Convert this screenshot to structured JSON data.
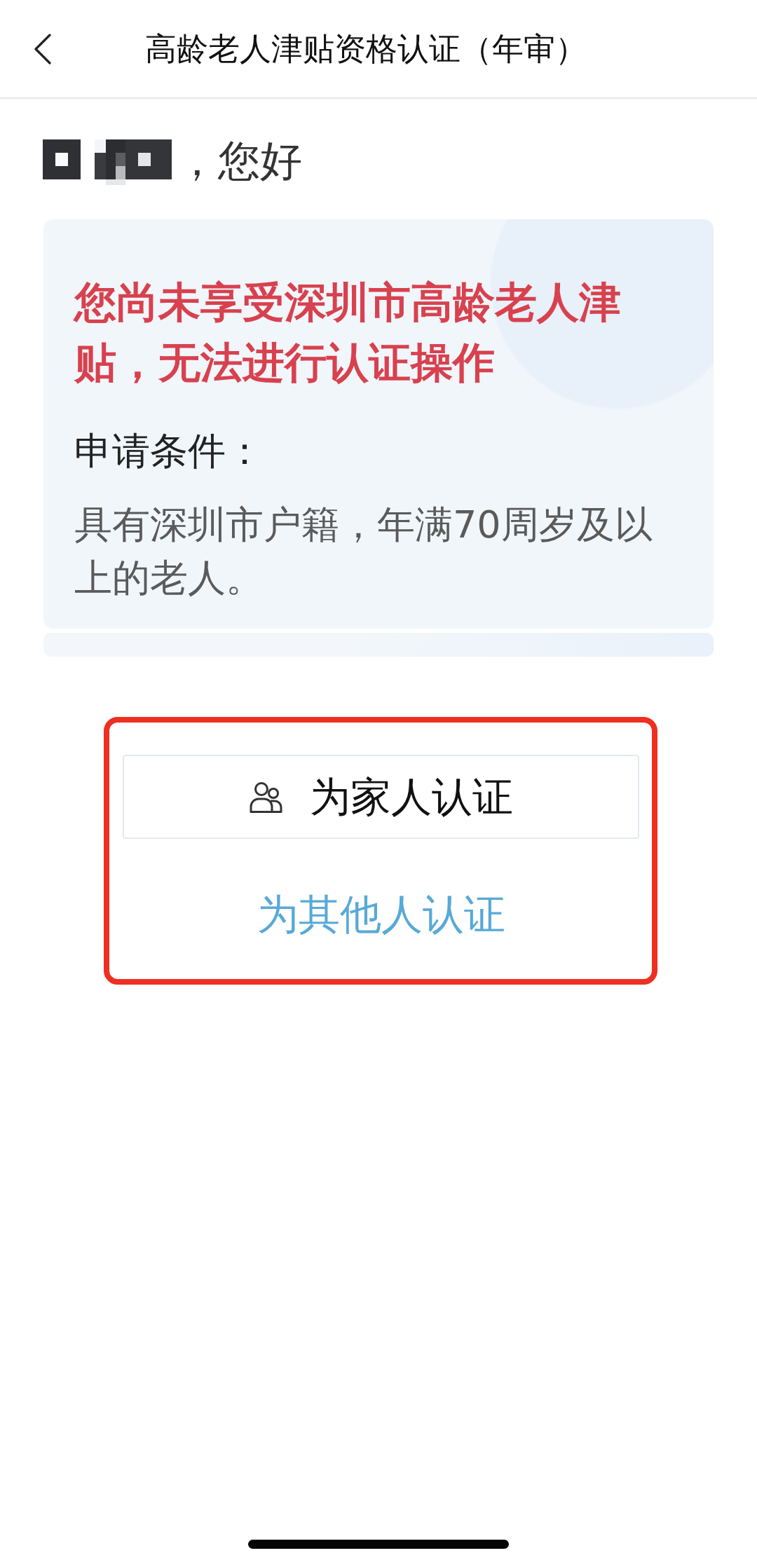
{
  "header": {
    "title": "高龄老人津贴资格认证（年审）"
  },
  "greeting": {
    "text": "，您好"
  },
  "notice": {
    "title": "您尚未享受深圳市高龄老人津贴，无法进行认证操作",
    "conditions_label": "申请条件：",
    "conditions": "具有深圳市户籍，年满70周岁及以上的老人。"
  },
  "actions": [
    {
      "kind": "outlined",
      "label": "为家人认证"
    },
    {
      "kind": "link",
      "label": "为其他人认证"
    }
  ]
}
